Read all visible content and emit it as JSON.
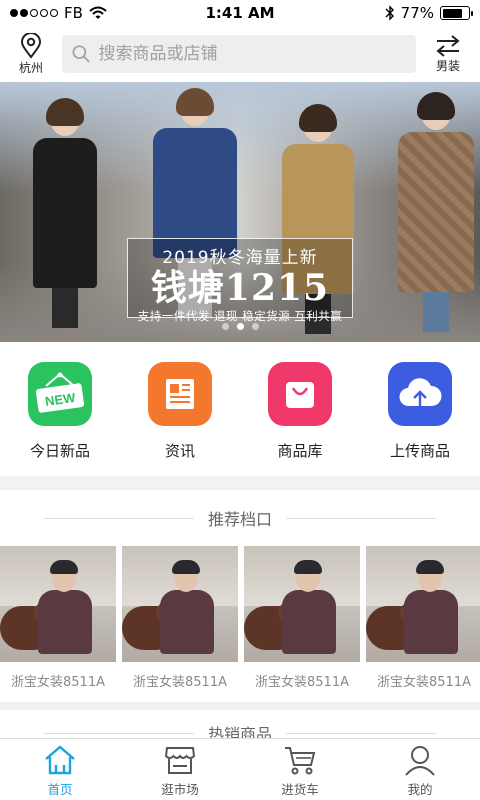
{
  "status": {
    "carrier": "FB",
    "time": "1:41 AM",
    "battery": "77%",
    "battery_level": 0.77
  },
  "header": {
    "location": "杭州",
    "search_placeholder": "搜索商品或店铺",
    "switch_label": "男装"
  },
  "banner": {
    "caption_top": "2019秋冬海量上新",
    "caption_main": "钱塘1215",
    "caption_sub": "支持一件代发 退现 稳定货源 互利共赢",
    "slides": 3,
    "active_slide": 1
  },
  "quick_links": [
    {
      "label": "今日新品",
      "icon": "new-badge-icon",
      "color": "#2bc35f"
    },
    {
      "label": "资讯",
      "icon": "news-icon",
      "color": "#f4772e"
    },
    {
      "label": "商品库",
      "icon": "shopping-bag-icon",
      "color": "#f0386a"
    },
    {
      "label": "上传商品",
      "icon": "cloud-upload-icon",
      "color": "#3d5de0"
    }
  ],
  "shops_section": {
    "title": "推荐档口",
    "shops": [
      {
        "name": "浙宝女装8511A"
      },
      {
        "name": "浙宝女装8511A"
      },
      {
        "name": "浙宝女装8511A"
      },
      {
        "name": "浙宝女装8511A"
      }
    ]
  },
  "hot_section": {
    "title": "热销商品"
  },
  "tabs": [
    {
      "label": "首页",
      "icon": "home-icon",
      "active": true
    },
    {
      "label": "逛市场",
      "icon": "market-icon",
      "active": false
    },
    {
      "label": "进货车",
      "icon": "cart-icon",
      "active": false
    },
    {
      "label": "我的",
      "icon": "profile-icon",
      "active": false
    }
  ],
  "colors": {
    "accent": "#1aa3e0",
    "tab_inactive": "#555555"
  }
}
